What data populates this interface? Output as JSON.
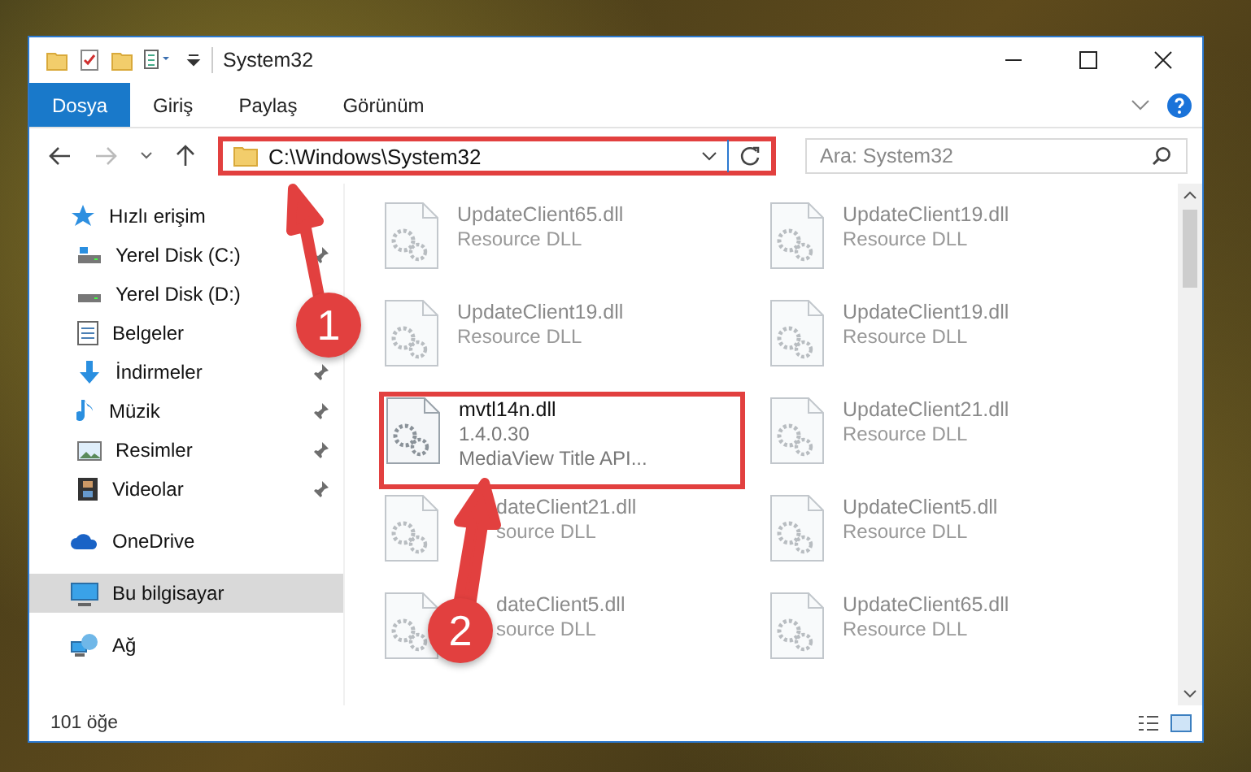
{
  "window": {
    "title": "System32"
  },
  "ribbon_tabs": [
    {
      "label": "Dosya",
      "kind": "file"
    },
    {
      "label": "Giriş",
      "kind": "tab"
    },
    {
      "label": "Paylaş",
      "kind": "tab"
    },
    {
      "label": "Görünüm",
      "kind": "tab"
    }
  ],
  "address_bar": {
    "path": "C:\\Windows\\System32",
    "highlighted": true
  },
  "search": {
    "placeholder": "Ara: System32"
  },
  "sidebar": {
    "items": [
      {
        "label": "Hızlı erişim",
        "selected": false,
        "children": [
          {
            "label": "Yerel Disk (C:)",
            "pinned": true
          },
          {
            "label": "Yerel Disk (D:)",
            "pinned": false
          },
          {
            "label": "Belgeler",
            "pinned": false
          },
          {
            "label": "İndirmeler",
            "pinned": true
          },
          {
            "label": "Müzik",
            "pinned": true
          },
          {
            "label": "Resimler",
            "pinned": true
          },
          {
            "label": "Videolar",
            "pinned": true
          }
        ]
      },
      {
        "label": "OneDrive",
        "selected": false
      },
      {
        "label": "Bu bilgisayar",
        "selected": true
      },
      {
        "label": "Ağ",
        "selected": false
      }
    ]
  },
  "files": [
    {
      "name": "UpdateClient65.dll",
      "details": [
        "Resource DLL"
      ],
      "blurred": true,
      "highlighted": false
    },
    {
      "name": "UpdateClient19.dll",
      "details": [
        "Resource DLL"
      ],
      "blurred": true,
      "highlighted": false
    },
    {
      "name": "UpdateClient19.dll",
      "details": [
        "Resource DLL"
      ],
      "blurred": true,
      "highlighted": false
    },
    {
      "name": "UpdateClient19.dll",
      "details": [
        "Resource DLL"
      ],
      "blurred": true,
      "highlighted": false
    },
    {
      "name": "mvtl14n.dll",
      "details": [
        "1.4.0.30",
        "MediaView Title API..."
      ],
      "blurred": false,
      "highlighted": true
    },
    {
      "name": "UpdateClient21.dll",
      "details": [
        "Resource DLL"
      ],
      "blurred": true,
      "highlighted": false
    },
    {
      "name": "dateClient21.dll",
      "details": [
        "source DLL"
      ],
      "blurred": true,
      "highlighted": false
    },
    {
      "name": "UpdateClient5.dll",
      "details": [
        "Resource DLL"
      ],
      "blurred": true,
      "highlighted": false
    },
    {
      "name": "dateClient5.dll",
      "details": [
        "source DLL"
      ],
      "blurred": true,
      "highlighted": false
    },
    {
      "name": "UpdateClient65.dll",
      "details": [
        "Resource DLL"
      ],
      "blurred": true,
      "highlighted": false
    }
  ],
  "callouts": [
    "1",
    "2"
  ],
  "status_bar": {
    "count": "101 öğe"
  }
}
